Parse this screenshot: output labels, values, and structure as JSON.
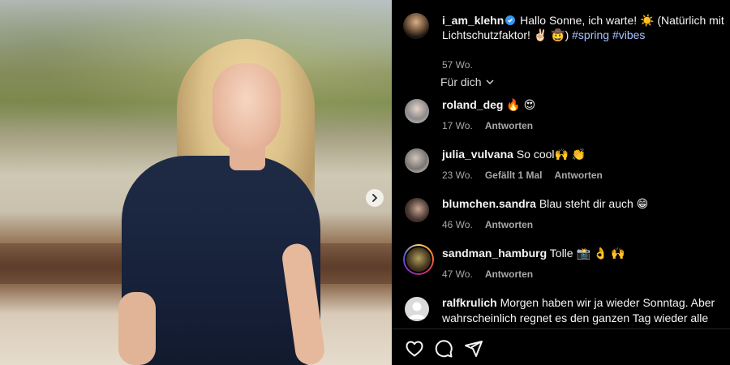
{
  "post": {
    "username": "i_am_klehn",
    "caption": "Hallo Sonne, ich warte! ☀️ (Natürlich mit Lichtschutzfaktor! ✌🏻 🤠)",
    "hashtags": "#spring #vibes",
    "time": "57 Wo."
  },
  "sort_label": "Für dich",
  "comments": [
    {
      "username": "roland_deg",
      "text": "🔥 😍",
      "time": "17 Wo.",
      "likes": "",
      "reply": "Antworten"
    },
    {
      "username": "julia_vulvana",
      "text": "So cool🙌 👏",
      "time": "23 Wo.",
      "likes": "Gefällt 1 Mal",
      "reply": "Antworten"
    },
    {
      "username": "blumchen.sandra",
      "text": "Blau steht dir auch 😁",
      "time": "46 Wo.",
      "likes": "",
      "reply": "Antworten"
    },
    {
      "username": "sandman_hamburg",
      "text": "Tolle 📸 👌 🙌",
      "time": "47 Wo.",
      "likes": "",
      "reply": "Antworten"
    },
    {
      "username": "ralfkrulich",
      "text": "Morgen haben wir ja wieder Sonntag. Aber wahrscheinlich regnet es den ganzen Tag wieder alle",
      "time": "",
      "likes": "",
      "reply": ""
    }
  ],
  "icons": {
    "like": "heart-icon",
    "comment": "comment-icon",
    "share": "send-icon",
    "next": "chevron-right-icon",
    "verified": "verified-badge-icon",
    "sort": "chevron-down-icon"
  },
  "colors": {
    "background": "#000000",
    "text": "#f5f5f5",
    "muted": "#a8a8a8",
    "hashtag": "#a9c4ff",
    "verified": "#3897f0"
  }
}
